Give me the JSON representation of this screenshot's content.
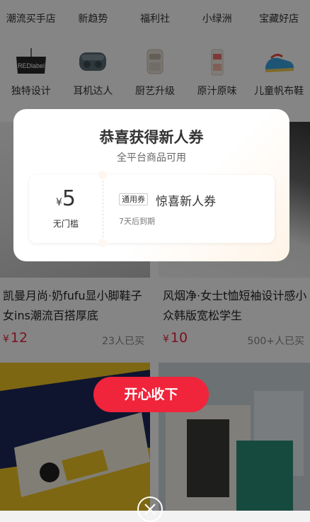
{
  "categories_row1": [
    {
      "label": "潮流买手店"
    },
    {
      "label": "新趋势"
    },
    {
      "label": "福利社"
    },
    {
      "label": "小绿洲"
    },
    {
      "label": "宝藏好店"
    }
  ],
  "categories_row2": [
    {
      "label": "独特设计",
      "icon": "redlabel-tag-icon",
      "logo_text": "REDlabel"
    },
    {
      "label": "耳机达人",
      "icon": "earbuds-icon"
    },
    {
      "label": "厨艺升级",
      "icon": "air-fryer-icon"
    },
    {
      "label": "原汁原味",
      "icon": "juice-cup-icon"
    },
    {
      "label": "儿童帆布鞋",
      "icon": "kids-sneaker-icon"
    }
  ],
  "products": [
    {
      "title": "凯曼月尚·奶fufu显小脚鞋子女ins潮流百搭厚底",
      "currency": "¥",
      "price": "12",
      "sold": "23人已买"
    },
    {
      "title": "风烟净·女士t恤短袖设计感小众韩版宽松学生",
      "currency": "¥",
      "price": "10",
      "sold": "500+人已买"
    }
  ],
  "modal": {
    "title": "恭喜获得新人券",
    "subtitle": "全平台商品可用",
    "coupon": {
      "currency": "¥",
      "amount": "5",
      "threshold": "无门槛",
      "badge": "通用券",
      "name": "惊喜新人券",
      "expiry": "7天后到期"
    },
    "confirm_label": "开心收下"
  },
  "colors": {
    "accent": "#f0243b",
    "price": "#e8243b"
  }
}
